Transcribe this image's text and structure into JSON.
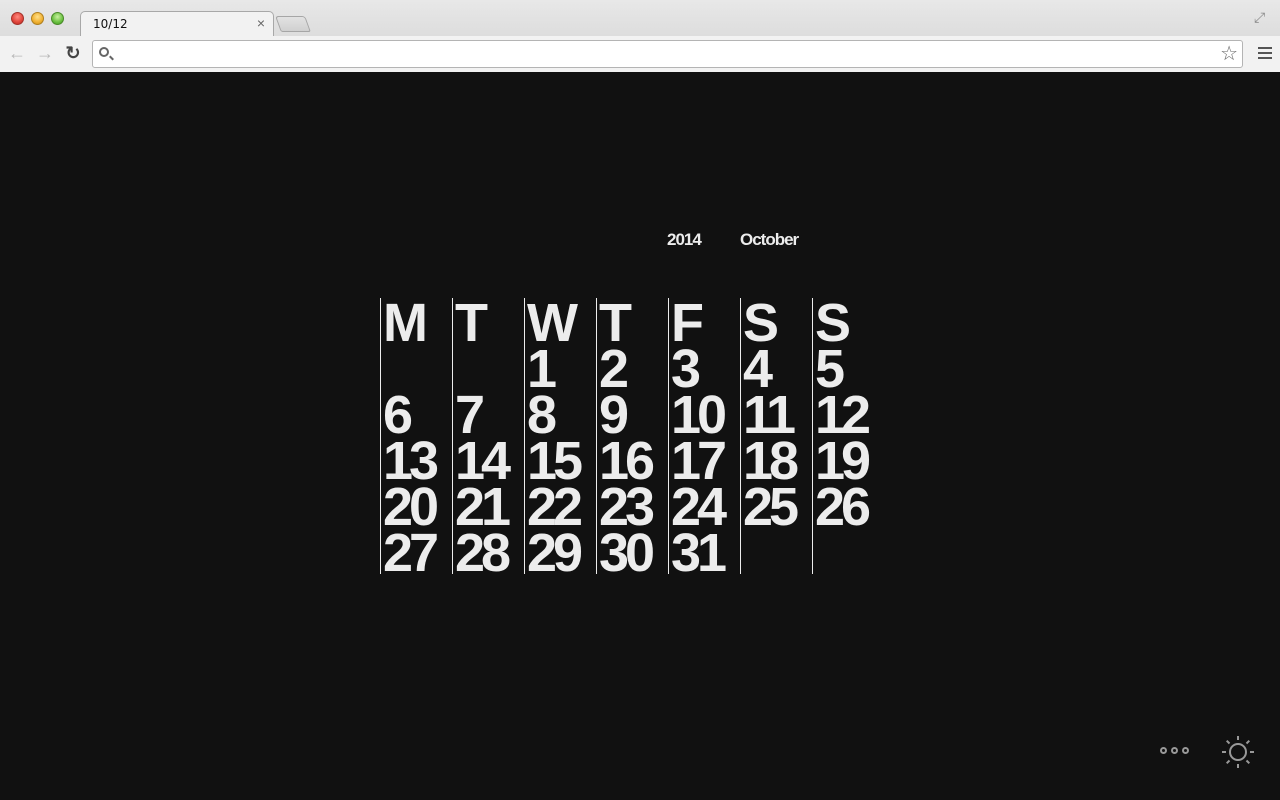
{
  "browser": {
    "tab_title": "10/12",
    "tab_close": "×",
    "url_value": "",
    "url_placeholder": "",
    "icons": {
      "back": "←",
      "forward": "→",
      "reload": "↻",
      "star": "☆",
      "fullscreen": "⤢"
    }
  },
  "calendar": {
    "year": "2014",
    "month": "October",
    "columns": [
      {
        "day": "M",
        "dates": [
          "",
          "6",
          "13",
          "20",
          "27"
        ]
      },
      {
        "day": "T",
        "dates": [
          "",
          "7",
          "14",
          "21",
          "28"
        ]
      },
      {
        "day": "W",
        "dates": [
          "1",
          "8",
          "15",
          "22",
          "29"
        ]
      },
      {
        "day": "T",
        "dates": [
          "2",
          "9",
          "16",
          "23",
          "30"
        ]
      },
      {
        "day": "F",
        "dates": [
          "3",
          "10",
          "17",
          "24",
          "31"
        ]
      },
      {
        "day": "S",
        "dates": [
          "4",
          "11",
          "18",
          "25",
          ""
        ]
      },
      {
        "day": "S",
        "dates": [
          "5",
          "12",
          "19",
          "26",
          ""
        ]
      }
    ]
  },
  "controls": {
    "more_icon": "more-options",
    "theme_icon": "brightness-toggle"
  }
}
